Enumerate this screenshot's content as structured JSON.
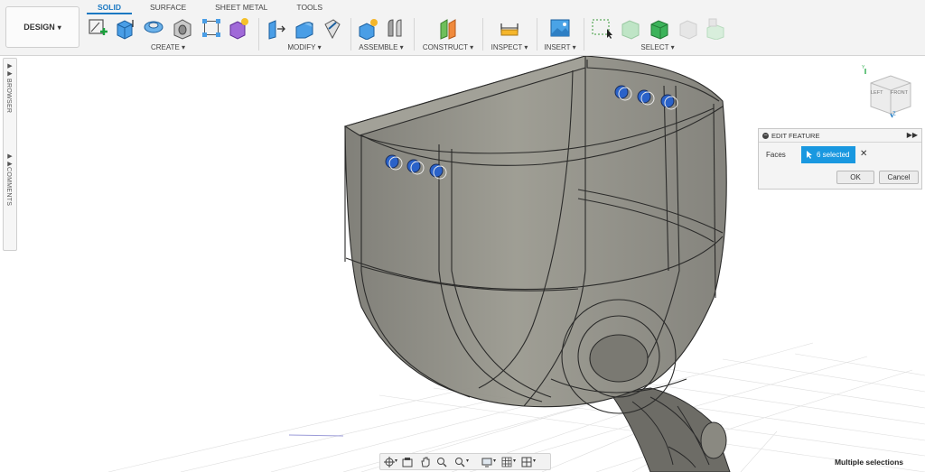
{
  "toolbar": {
    "design_label": "DESIGN",
    "tabs": [
      "SOLID",
      "SURFACE",
      "SHEET METAL",
      "TOOLS"
    ],
    "groups": {
      "create": "CREATE",
      "modify": "MODIFY",
      "assemble": "ASSEMBLE",
      "construct": "CONSTRUCT",
      "inspect": "INSPECT",
      "insert": "INSERT",
      "select": "SELECT"
    },
    "dropdown_glyph": "▾"
  },
  "siderail": {
    "browser": "BROWSER",
    "comments": "COMMENTS"
  },
  "viewcube": {
    "left": "LEFT",
    "front": "FRONT",
    "axis_z": "Z",
    "axis_y": "Y"
  },
  "edit_feature": {
    "title": "EDIT FEATURE",
    "field_label": "Faces",
    "selection_value": "6 selected",
    "ok": "OK",
    "cancel": "Cancel"
  },
  "status_text": "Multiple selections",
  "colors": {
    "accent": "#1a78c2",
    "selection": "#1998e0",
    "model_fill": "#8b8a83",
    "highlight_faces": "#2a62c9"
  }
}
